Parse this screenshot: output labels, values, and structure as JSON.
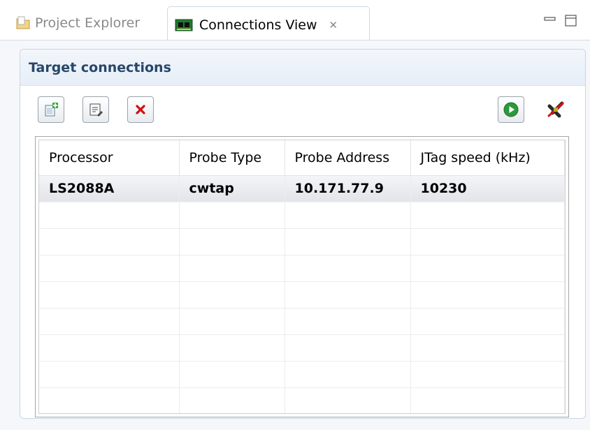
{
  "tabs": {
    "project_explorer": "Project Explorer",
    "connections_view": "Connections View"
  },
  "section": {
    "title": "Target connections"
  },
  "table": {
    "columns": [
      "Processor",
      "Probe Type",
      "Probe Address",
      "JTag speed (kHz)"
    ],
    "rows": [
      [
        "LS2088A",
        "cwtap",
        "10.171.77.9",
        "10230"
      ],
      [
        "",
        "",
        "",
        ""
      ],
      [
        "",
        "",
        "",
        ""
      ],
      [
        "",
        "",
        "",
        ""
      ],
      [
        "",
        "",
        "",
        ""
      ],
      [
        "",
        "",
        "",
        ""
      ],
      [
        "",
        "",
        "",
        ""
      ],
      [
        "",
        "",
        "",
        ""
      ],
      [
        "",
        "",
        "",
        ""
      ]
    ]
  },
  "icons": {
    "add": "add-connection-icon",
    "edit": "edit-connection-icon",
    "delete": "delete-connection-icon",
    "connect": "connect-icon",
    "disconnect": "disconnect-icon"
  },
  "colors": {
    "section_title": "#27466a",
    "delete_red": "#cc1111",
    "connect_green": "#2b9a3a"
  }
}
